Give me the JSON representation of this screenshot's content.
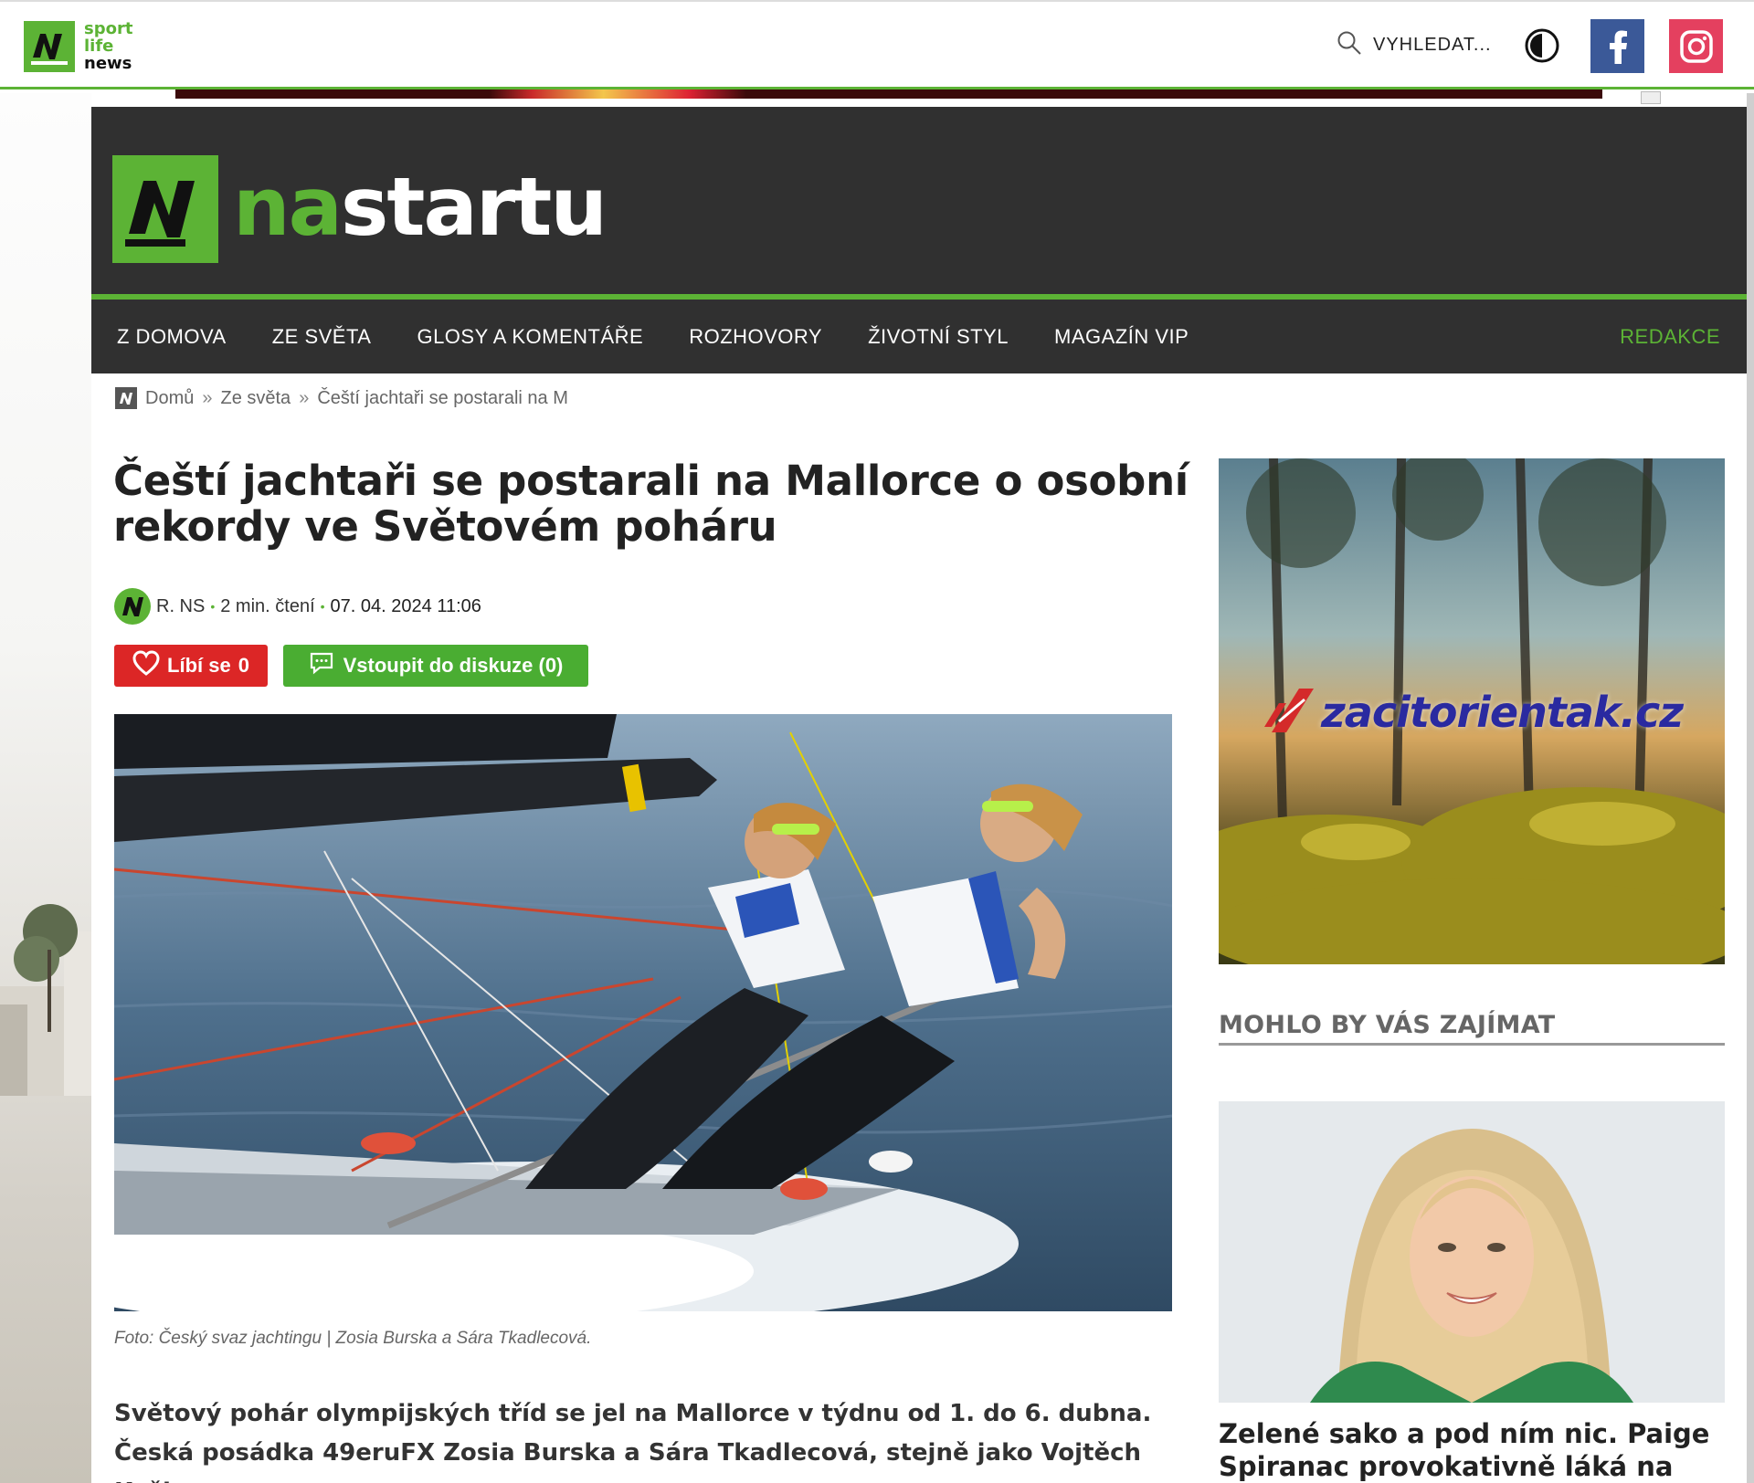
{
  "topbar": {
    "logo_words": [
      "sport",
      "life",
      "news"
    ],
    "search_label": "VYHLEDAT...",
    "icons": [
      "search-icon",
      "contrast-icon",
      "facebook-icon",
      "instagram-icon"
    ],
    "colors": {
      "brand_green": "#5cb335",
      "facebook": "#3b5998",
      "instagram": "#e4405f"
    }
  },
  "masthead": {
    "logo_na": "na",
    "logo_startu": "startu",
    "colors": {
      "bg": "#303030"
    }
  },
  "nav": {
    "items": [
      "Z DOMOVA",
      "ZE SVĚTA",
      "GLOSY A KOMENTÁŘE",
      "ROZHOVORY",
      "ŽIVOTNÍ STYL",
      "MAGAZÍN VIP"
    ],
    "right": "REDAKCE"
  },
  "breadcrumb": {
    "items": [
      "Domů",
      "Ze světa",
      "Čeští jachtaři se postarali na M"
    ],
    "separator": "»"
  },
  "article": {
    "title": "Čeští jachtaři se postarali na Mallorce o osobní rekordy ve Světovém poháru",
    "author": "R. NS",
    "read_time": "2 min. čtení",
    "date": "07. 04. 2024 11:06",
    "like_label": "Líbí se",
    "like_count": "0",
    "discussion_label": "Vstoupit do diskuze (0)",
    "photo_caption": "Foto: Český svaz jachtingu | Zosia Burska a Sára Tkadlecová.",
    "lead": "Světový pohár olympijských tříd se jel na Mallorce v týdnu od 1. do 6. dubna. Česká posádka 49eruFX Zosia Burska a Sára Tkadlecová, stejně jako Vojtěch Koška ve"
  },
  "sidebar": {
    "ad_text": "zacitorientak.cz",
    "section_heading": "MOHLO BY VÁS ZAJÍMAT",
    "card_title": "Zelené sako a pod ním nic. Paige Spiranac provokativně láká na"
  }
}
